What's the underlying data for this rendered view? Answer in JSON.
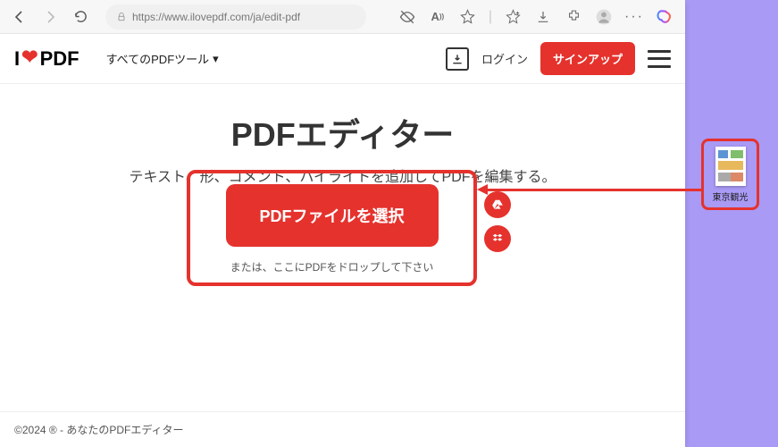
{
  "browser": {
    "url": "https://www.ilovepdf.com/ja/edit-pdf"
  },
  "site": {
    "logo_text_1": "I",
    "logo_text_2": "PDF",
    "menu_all_tools": "すべてのPDFツール",
    "login": "ログイン",
    "signup": "サインアップ"
  },
  "page": {
    "title": "PDFエディター",
    "subtitle": "テキスト、形、コメント、ハイライトを追加してPDFを編集する。",
    "select_button": "PDFファイルを選択",
    "drop_text": "または、ここにPDFをドロップして下さい",
    "footer": "©2024 ® - あなたのPDFエディター"
  },
  "desktop": {
    "file_name": "東京観光"
  }
}
